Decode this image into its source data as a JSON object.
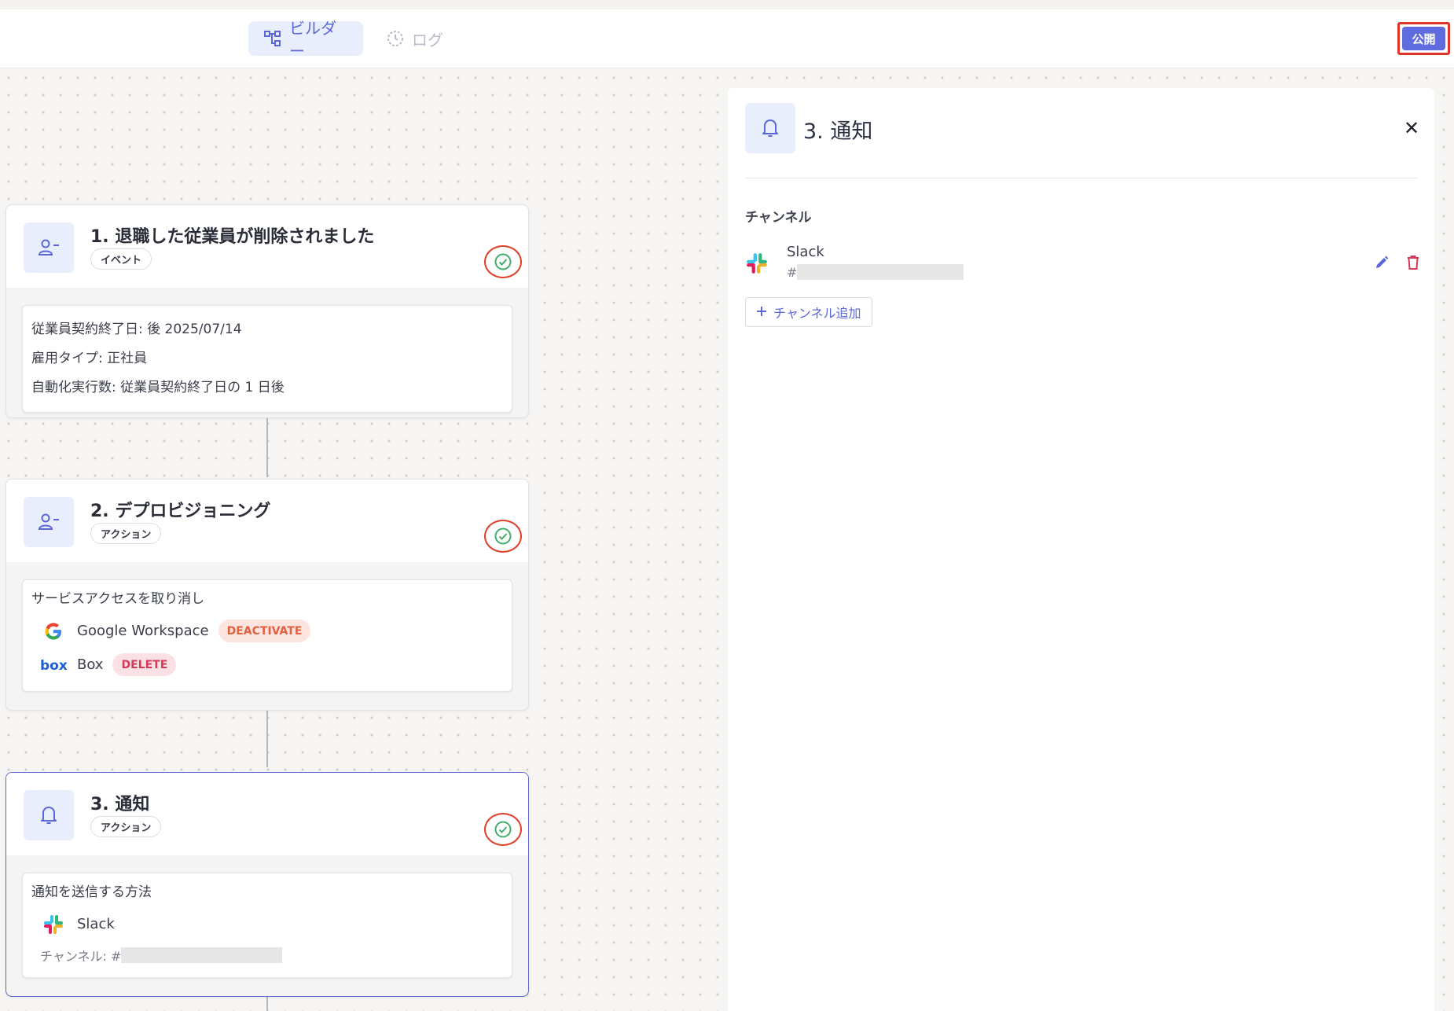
{
  "topbar": {
    "tabs": [
      {
        "label": "ビルダー",
        "active": true,
        "icon": "workflow-icon"
      },
      {
        "label": "ログ",
        "active": false,
        "icon": "clock-icon"
      }
    ],
    "publish_label": "公開"
  },
  "cards": [
    {
      "title": "1. 退職した従業員が削除されました",
      "badge": "イベント",
      "icon": "user-minus-icon",
      "lines": [
        "従業員契約終了日: 後 2025/07/14",
        "雇用タイプ: 正社員",
        "自動化実行数: 従業員契約終了日の 1 日後"
      ]
    },
    {
      "title": "2. デプロビジョニング",
      "badge": "アクション",
      "icon": "user-minus-icon",
      "heading": "サービスアクセスを取り消し",
      "services": [
        {
          "name": "Google Workspace",
          "action": "DEACTIVATE"
        },
        {
          "name": "Box",
          "action": "DELETE"
        }
      ]
    },
    {
      "title": "3. 通知",
      "badge": "アクション",
      "icon": "bell-icon",
      "heading": "通知を送信する方法",
      "service": "Slack",
      "channel_label": "チャンネル: #"
    }
  ],
  "panel": {
    "title": "3. 通知",
    "close": "✕",
    "section_label": "チャンネル",
    "channel": {
      "name": "Slack",
      "id_prefix": "#"
    },
    "add_channel_label": "チャンネル追加"
  },
  "colors": {
    "accent": "#5f6ce0",
    "highlight_border": "#e0342a",
    "check_green": "#3fae6b",
    "deactivate": "#e0613f",
    "delete": "#d23a5a"
  }
}
